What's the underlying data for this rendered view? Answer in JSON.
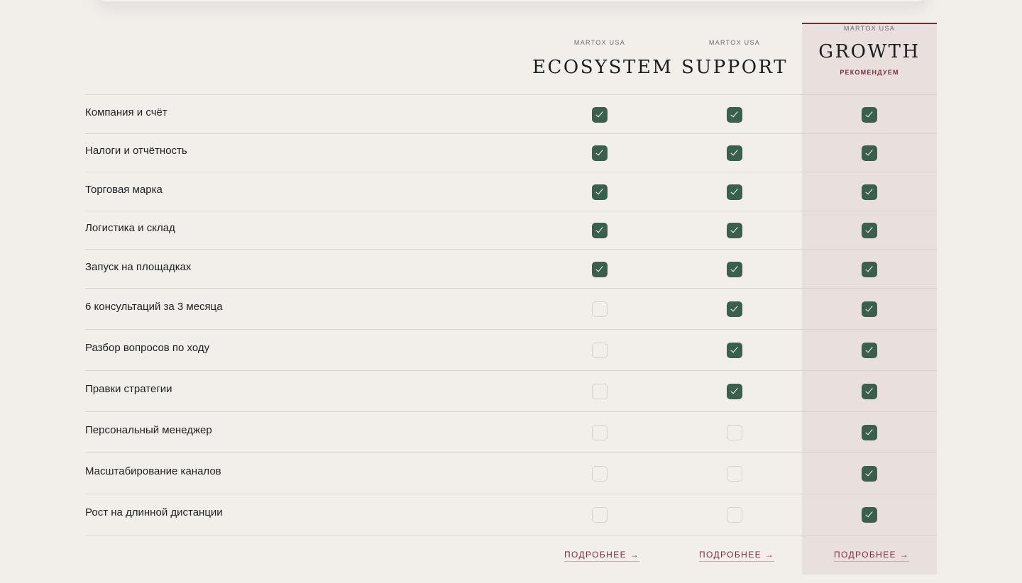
{
  "plans": [
    {
      "brand": "MARTOX USA",
      "name": "ECOSYSTEM",
      "badge": ""
    },
    {
      "brand": "MARTOX USA",
      "name": "SUPPORT",
      "badge": ""
    },
    {
      "brand": "MARTOX USA",
      "name": "GROWTH",
      "badge": "РЕКОМЕНДУЕМ"
    }
  ],
  "features": [
    {
      "label": "Компания и счёт",
      "checks": [
        true,
        true,
        true
      ]
    },
    {
      "label": "Налоги и отчётность",
      "checks": [
        true,
        true,
        true
      ]
    },
    {
      "label": "Торговая марка",
      "checks": [
        true,
        true,
        true
      ]
    },
    {
      "label": "Логистика и склад",
      "checks": [
        true,
        true,
        true
      ]
    },
    {
      "label": "Запуск на площадках",
      "checks": [
        true,
        true,
        true
      ]
    },
    {
      "label": "6 консультаций за 3 месяца",
      "checks": [
        false,
        true,
        true
      ]
    },
    {
      "label": "Разбор вопросов по ходу",
      "checks": [
        false,
        true,
        true
      ]
    },
    {
      "label": "Правки стратегии",
      "checks": [
        false,
        true,
        true
      ]
    },
    {
      "label": "Персональный менеджер",
      "checks": [
        false,
        false,
        true
      ]
    },
    {
      "label": "Масштабирование каналов",
      "checks": [
        false,
        false,
        true
      ]
    },
    {
      "label": "Рост на длинной дистанции",
      "checks": [
        false,
        false,
        true
      ]
    }
  ],
  "more_links": [
    "ПОДРОБНЕЕ →",
    "ПОДРОБНЕЕ →",
    "ПОДРОБНЕЕ →"
  ],
  "colors": {
    "accent": "#7d2a35",
    "check": "#3a604c",
    "highlight": "#e9e0de",
    "background": "#f2efeb"
  }
}
